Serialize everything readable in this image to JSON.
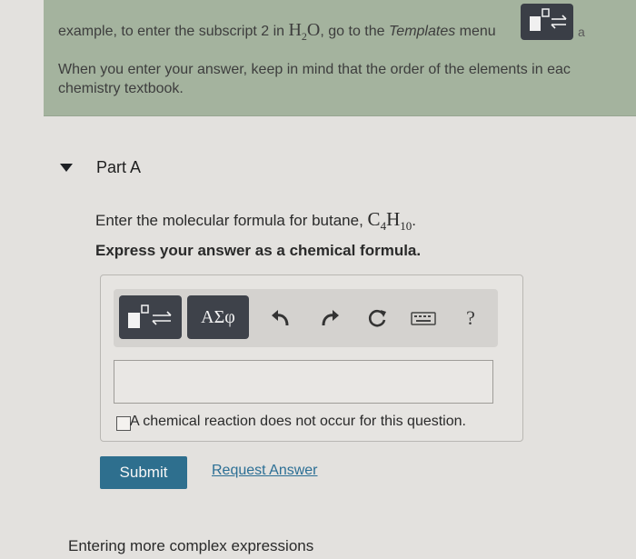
{
  "instructions": {
    "line1_before": "example, to enter the subscript 2 in ",
    "formula_H": "H",
    "formula_sub": "2",
    "formula_O": "O",
    "line1_mid": ", go to the ",
    "line1_templates": "Templates",
    "line1_after": " menu",
    "line2": "When you enter your answer, keep in mind that the order of the elements in eac",
    "line3": "chemistry textbook.",
    "edge_text": "a"
  },
  "part": {
    "title": "Part A",
    "question_prefix": "Enter the molecular formula for butane, ",
    "formula_C": "C",
    "formula_C_sub": "4",
    "formula_H": "H",
    "formula_H_sub": "10",
    "question_suffix": ".",
    "express": "Express your answer as a chemical formula."
  },
  "toolbar": {
    "symbols_label": "ΑΣφ",
    "help_label": "?"
  },
  "answer": {
    "value": "",
    "placeholder": ""
  },
  "no_reaction_label": "A chemical reaction does not occur for this question.",
  "actions": {
    "submit": "Submit",
    "request_answer": "Request Answer"
  },
  "footer": {
    "heading": "Entering more complex expressions"
  },
  "colors": {
    "instruction_bg": "#a4b39e",
    "toolbar_button": "#3e424a",
    "submit_bg": "#2e6f8e",
    "link": "#2c6f95"
  }
}
